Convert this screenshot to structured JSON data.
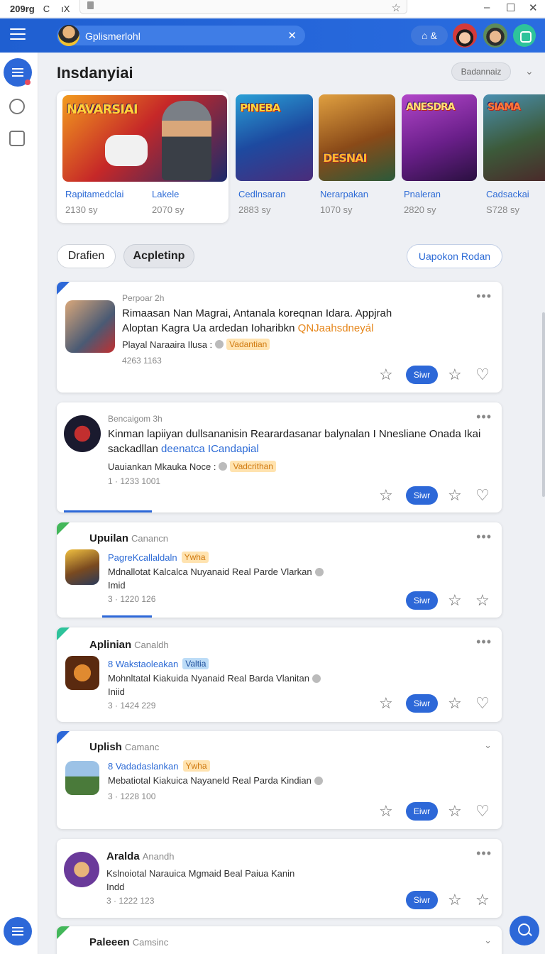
{
  "sysbar": {
    "left_text": "209rg",
    "refresh": "C",
    "icon2": "ıX"
  },
  "header": {
    "search_text": "Gplismerlohl",
    "pill_text": "⌂ &"
  },
  "page": {
    "title": "Insdanyiai",
    "sort_label": "Badannaiz"
  },
  "featured": [
    {
      "label": "NAVARSIAI",
      "title": "Rapitamedclai",
      "sub": "2130 sy",
      "title2": "Lakele",
      "sub2": "2070 sy"
    },
    {
      "label": "PINEBA",
      "title": "Cedlnsaran",
      "sub": "2883 sy"
    },
    {
      "label": "DESNAI",
      "title": "Nerarpakan",
      "sub": "1070 sy"
    },
    {
      "label": "ANESDRA",
      "title": "Pnaleran",
      "sub": "2820 sy"
    },
    {
      "label": "SIAMA",
      "title": "Cadsackai",
      "sub": "S728 sy"
    }
  ],
  "filters": {
    "chip1": "Drafien",
    "chip2": "Acpletinp",
    "chip3": "Uapokon Rodan"
  },
  "cards": [
    {
      "meta": "Perpoar 2h",
      "line1": "Rimaasan Nan Magrai, Antanala koreqnan Idara. Appjrah",
      "line2a": "Aloptan Kagra Ua ardedan Ioharibkn ",
      "line2b": "QNJaahsdneyál",
      "line3": "Playal Naraaira Ilusa :",
      "tag": "Vadantian",
      "num": "4263 1163",
      "btn": "Siwr"
    },
    {
      "meta": "Bencaigom 3h",
      "line1": "Kinman lapiiyan dullsananisin Rearardasanar balynalan I Nnesliane Onada Ikai",
      "line2a": "sackadllan ",
      "line2b": "deenatca ICandapial",
      "line3": "Uauiankan Mkauka Noce :",
      "tag": "Vadcrithan",
      "num": "1 · 1233 1001",
      "btn": "Siwr"
    },
    {
      "name": "Upuilan",
      "nsub": "Canancn",
      "link": "PagreKcallaldaln",
      "tag": "Ywha",
      "line1": "Mdnallotat Kalcalca Nuyanaid Real Parde Vlarkan",
      "line2": "Imid",
      "num": "3 · 1220 126",
      "btn": "Siwr"
    },
    {
      "name": "Aplinian",
      "nsub": "Canaldh",
      "link": "8 Wakstaoleakan",
      "tag": "Valtia",
      "line1": "Mohnltatal Kiakuida Nyanaid Real Barda Vlanitan",
      "line2": "Iniid",
      "num": "3 · 1424 229",
      "btn": "Siwr"
    },
    {
      "name": "Uplish",
      "nsub": "Camanc",
      "link": "8 Vadadaslankan",
      "tag": "Ywha",
      "line1": "Mebatiotal Kiakuica Nayaneld Real Parda Kindian",
      "num": "3 · 1228 100",
      "btn": "Eiwr"
    },
    {
      "name": "Aralda",
      "nsub": "Anandh",
      "line1": "Kslnoiotal Narauica Mgmaid Beal Paiua Kanin",
      "line2": "Indd",
      "num": "3 · 1222 123",
      "btn": "Siwr"
    },
    {
      "name": "Paleeen",
      "nsub": "Camsinc"
    }
  ],
  "icons": {
    "menu": "hamburger-icon",
    "search": "search-icon",
    "star": "star-icon",
    "heart": "heart-icon",
    "more": "more-icon"
  }
}
